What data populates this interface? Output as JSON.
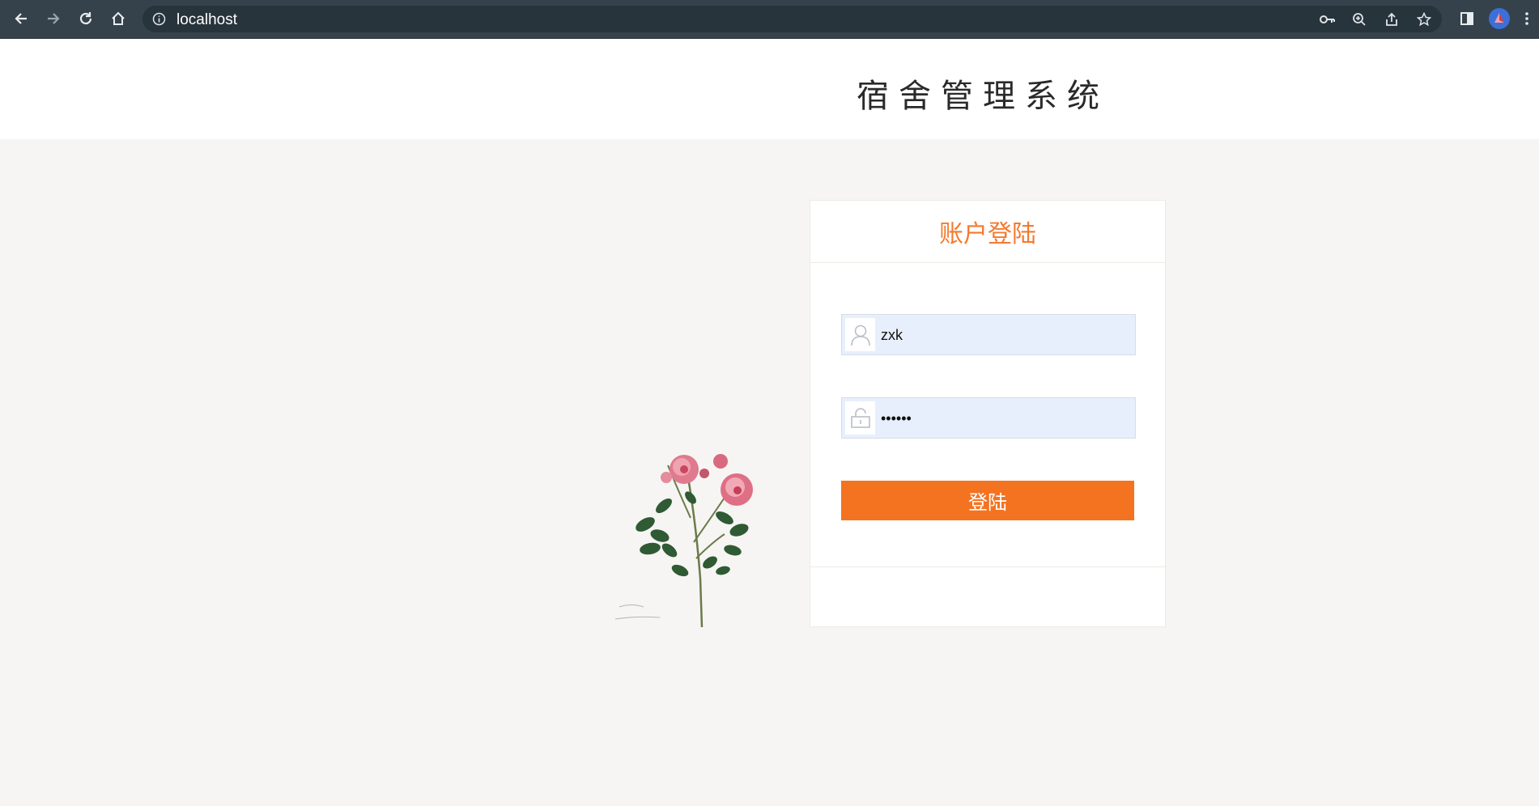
{
  "browser": {
    "url": "localhost",
    "icons": [
      "back-icon",
      "forward-icon",
      "reload-icon",
      "home-icon",
      "info-icon",
      "key-icon",
      "zoom-icon",
      "share-icon",
      "star-icon",
      "sidebar-icon",
      "profile-icon",
      "menu-icon"
    ]
  },
  "header": {
    "title": "宿舍管理系统"
  },
  "login": {
    "title": "账户登陆",
    "username": {
      "value": "zxk",
      "icon": "user-icon"
    },
    "password": {
      "value": "zxkzxk",
      "icon": "lock-icon"
    },
    "submit_label": "登陆"
  },
  "colors": {
    "accent": "#f47321",
    "chrome": "#35424b",
    "page_bg": "#f6f5f3",
    "input_bg": "#e8effc"
  }
}
